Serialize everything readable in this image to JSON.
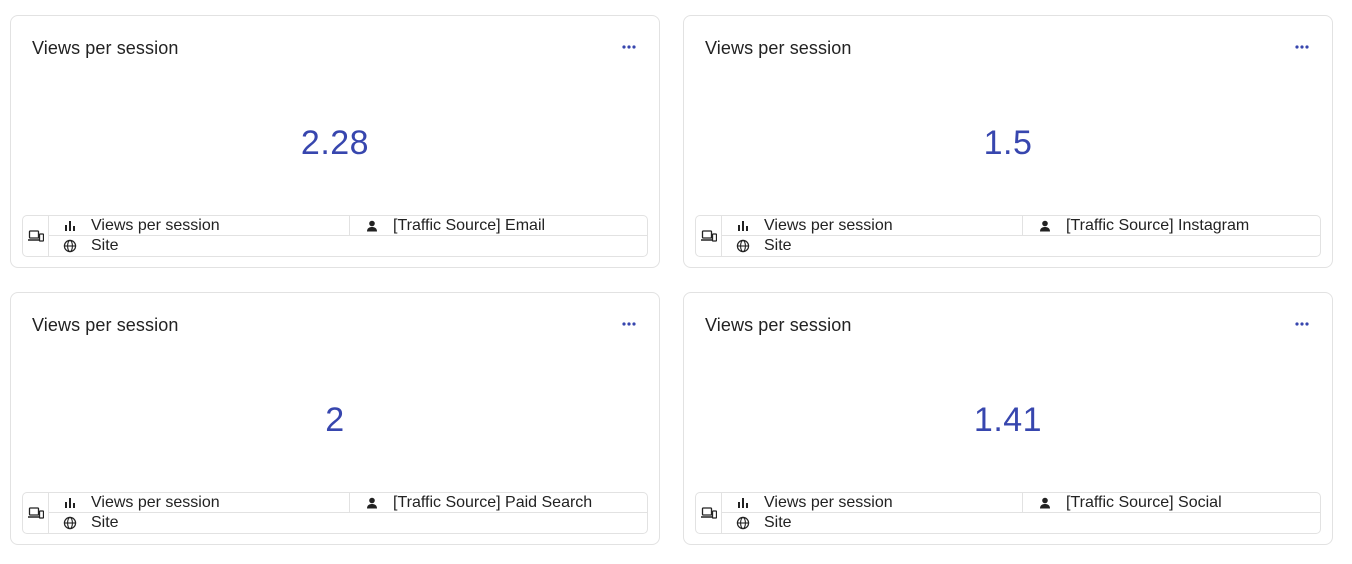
{
  "cards": [
    {
      "title": "Views per session",
      "value": "2.28",
      "metric": "Views per session",
      "segment": "[Traffic Source] Email",
      "scope": "Site"
    },
    {
      "title": "Views per session",
      "value": "1.5",
      "metric": "Views per session",
      "segment": "[Traffic Source] Instagram",
      "scope": "Site"
    },
    {
      "title": "Views per session",
      "value": "2",
      "metric": "Views per session",
      "segment": "[Traffic Source] Paid Search",
      "scope": "Site"
    },
    {
      "title": "Views per session",
      "value": "1.41",
      "metric": "Views per session",
      "segment": "[Traffic Source] Social",
      "scope": "Site"
    }
  ],
  "colors": {
    "accent": "#3746ae",
    "border": "#e2e2e2",
    "text": "#222222"
  },
  "icons": [
    "more-horizontal-icon",
    "devices-icon",
    "bar-chart-icon",
    "user-icon",
    "globe-icon"
  ]
}
